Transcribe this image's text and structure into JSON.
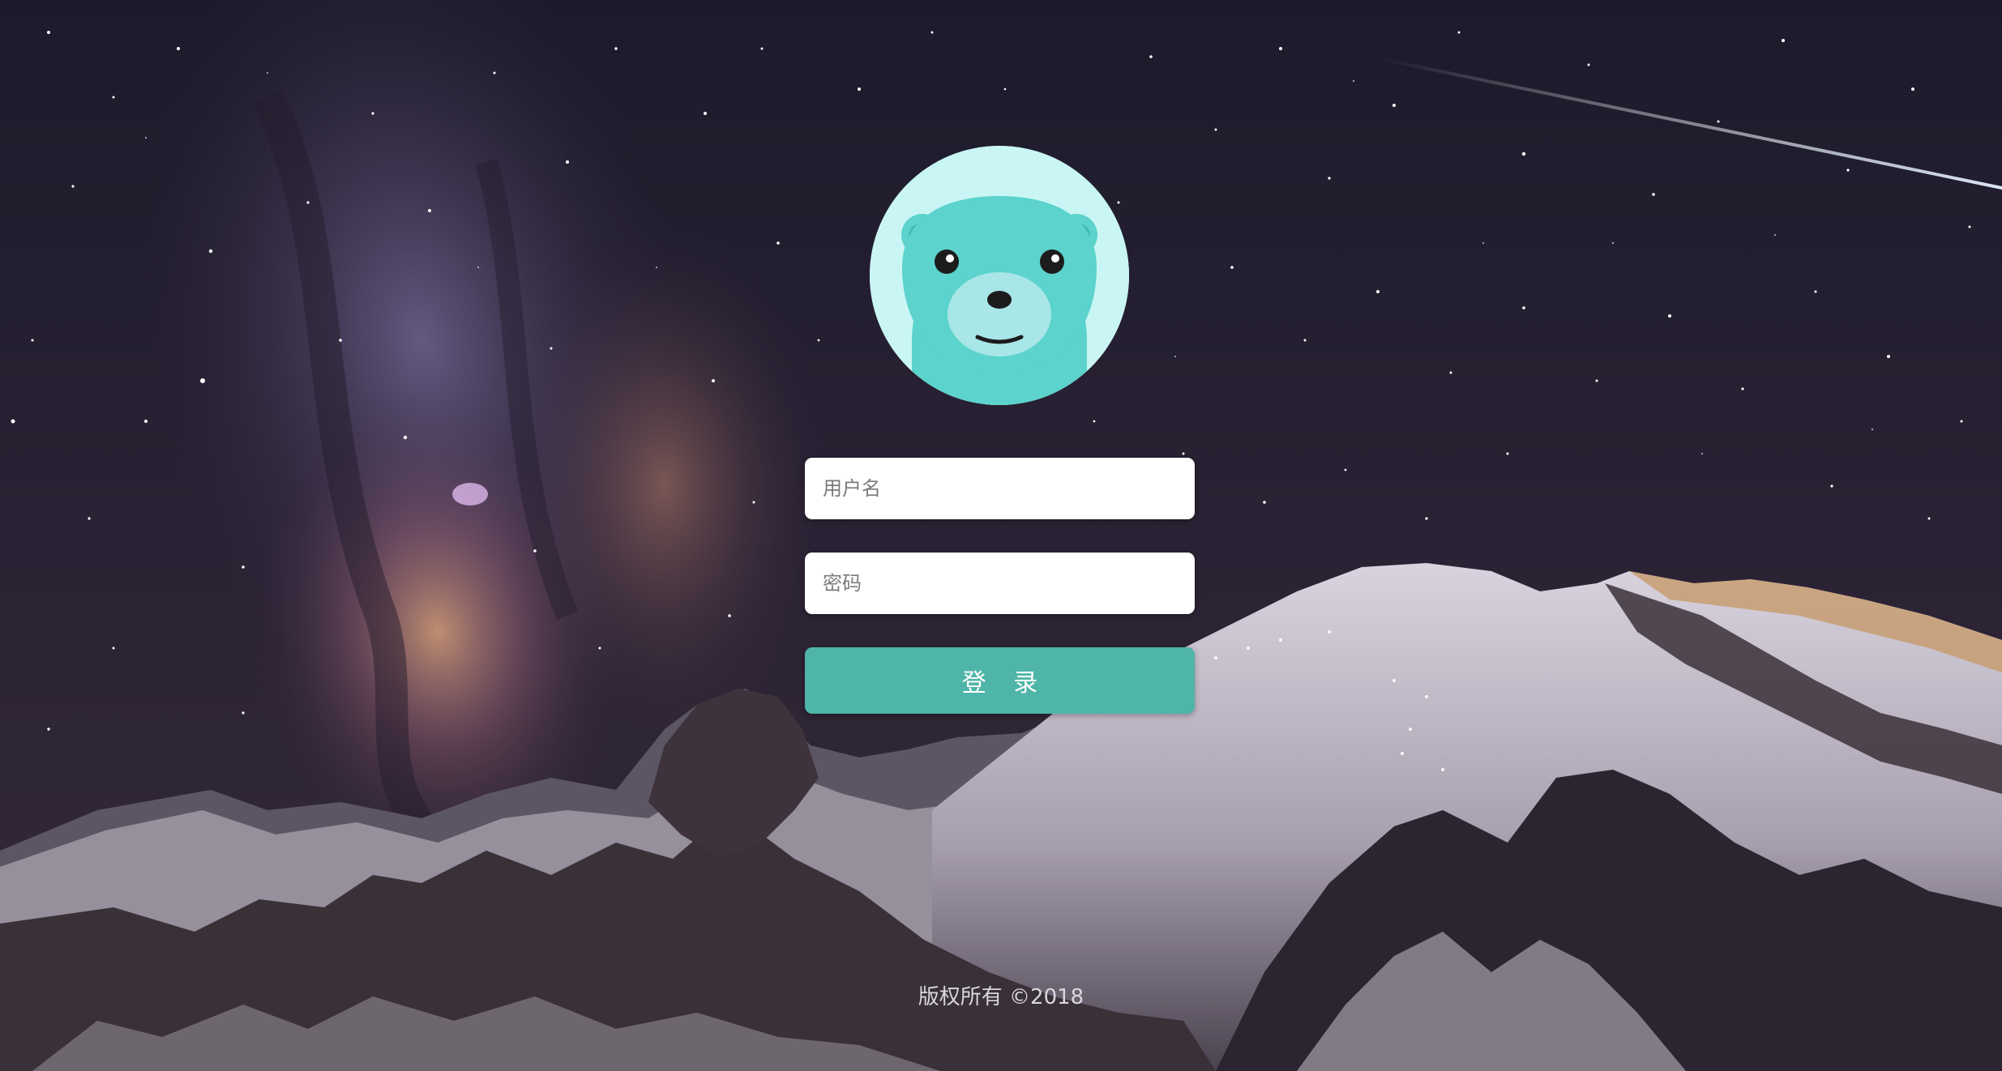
{
  "login_form": {
    "username_placeholder": "用户名",
    "password_placeholder": "密码",
    "submit_label": "登 录"
  },
  "footer": {
    "copyright": "版权所有 ©2018"
  },
  "avatar": {
    "icon": "bear-icon",
    "face_color": "#5cd3cc",
    "bg_color": "#c9f6f4"
  },
  "theme": {
    "button_color": "#4fb5a8",
    "footer_text_color": "#d8d6de"
  },
  "background": {
    "scene": "starry-night-snow-mountain"
  }
}
